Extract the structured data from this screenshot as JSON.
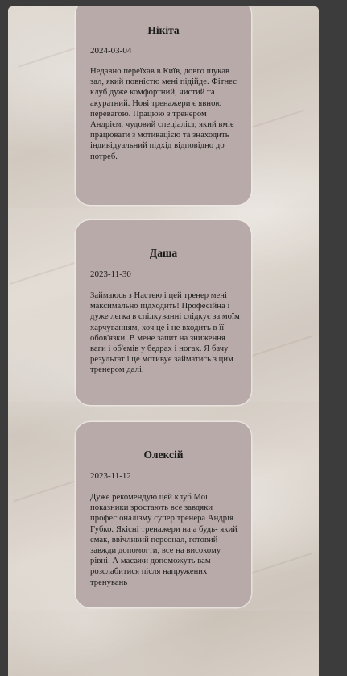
{
  "reviews": [
    {
      "name": "Нікіта",
      "date": "2024-03-04",
      "text": "Недавно переїхав в Київ, довго шукав зал, який повністю мені підійде. Фітнес клуб дуже комфортний, чистий та акуратний. Нові тренажери є явною перевагою. Працюю з тренером Андрієм, чудовий спеціаліст, який вміє працювати з мотивацією та знаходить індивідуальний підхід відповідно до потреб."
    },
    {
      "name": "Даша",
      "date": "2023-11-30",
      "text": "Займаюсь з Настею і цей тренер мені максимально підходить! Професійна і дуже легка в спілкуванні слідкує за моїм харчуванням, хоч це і не входить в її обов'язки. В мене запит на зниження ваги і об'ємів у бедрах і ногах. Я бачу результат і це мотивує займатись з цим тренером далі."
    },
    {
      "name": "Олексій",
      "date": "2023-11-12",
      "text": "Дуже рекомендую цей клуб Мої показники зростають все завдяки професіоналізму супер тренера Андрія Губко. Якісні тренажери на а будь- який смак, ввічливий персонал, готовий завжди допомогти, все на високому рівні. А масажи допоможуть вам розслабитися після напружених тренувань"
    }
  ]
}
